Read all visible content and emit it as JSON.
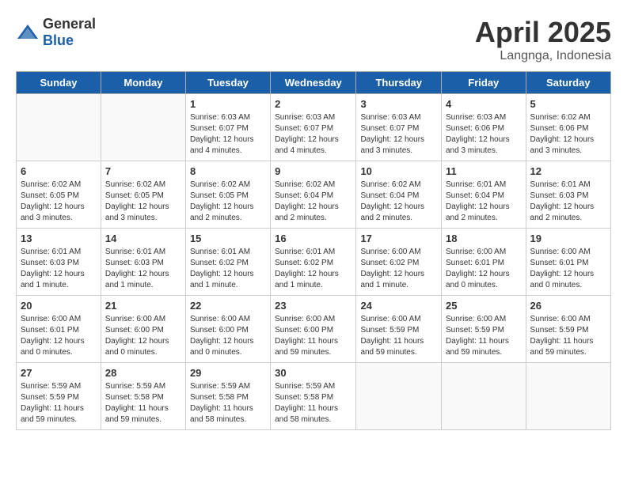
{
  "logo": {
    "text_general": "General",
    "text_blue": "Blue"
  },
  "header": {
    "title": "April 2025",
    "subtitle": "Langnga, Indonesia"
  },
  "calendar": {
    "weekdays": [
      "Sunday",
      "Monday",
      "Tuesday",
      "Wednesday",
      "Thursday",
      "Friday",
      "Saturday"
    ],
    "weeks": [
      [
        {
          "day": "",
          "info": ""
        },
        {
          "day": "",
          "info": ""
        },
        {
          "day": "1",
          "info": "Sunrise: 6:03 AM\nSunset: 6:07 PM\nDaylight: 12 hours\nand 4 minutes."
        },
        {
          "day": "2",
          "info": "Sunrise: 6:03 AM\nSunset: 6:07 PM\nDaylight: 12 hours\nand 4 minutes."
        },
        {
          "day": "3",
          "info": "Sunrise: 6:03 AM\nSunset: 6:07 PM\nDaylight: 12 hours\nand 3 minutes."
        },
        {
          "day": "4",
          "info": "Sunrise: 6:03 AM\nSunset: 6:06 PM\nDaylight: 12 hours\nand 3 minutes."
        },
        {
          "day": "5",
          "info": "Sunrise: 6:02 AM\nSunset: 6:06 PM\nDaylight: 12 hours\nand 3 minutes."
        }
      ],
      [
        {
          "day": "6",
          "info": "Sunrise: 6:02 AM\nSunset: 6:05 PM\nDaylight: 12 hours\nand 3 minutes."
        },
        {
          "day": "7",
          "info": "Sunrise: 6:02 AM\nSunset: 6:05 PM\nDaylight: 12 hours\nand 3 minutes."
        },
        {
          "day": "8",
          "info": "Sunrise: 6:02 AM\nSunset: 6:05 PM\nDaylight: 12 hours\nand 2 minutes."
        },
        {
          "day": "9",
          "info": "Sunrise: 6:02 AM\nSunset: 6:04 PM\nDaylight: 12 hours\nand 2 minutes."
        },
        {
          "day": "10",
          "info": "Sunrise: 6:02 AM\nSunset: 6:04 PM\nDaylight: 12 hours\nand 2 minutes."
        },
        {
          "day": "11",
          "info": "Sunrise: 6:01 AM\nSunset: 6:04 PM\nDaylight: 12 hours\nand 2 minutes."
        },
        {
          "day": "12",
          "info": "Sunrise: 6:01 AM\nSunset: 6:03 PM\nDaylight: 12 hours\nand 2 minutes."
        }
      ],
      [
        {
          "day": "13",
          "info": "Sunrise: 6:01 AM\nSunset: 6:03 PM\nDaylight: 12 hours\nand 1 minute."
        },
        {
          "day": "14",
          "info": "Sunrise: 6:01 AM\nSunset: 6:03 PM\nDaylight: 12 hours\nand 1 minute."
        },
        {
          "day": "15",
          "info": "Sunrise: 6:01 AM\nSunset: 6:02 PM\nDaylight: 12 hours\nand 1 minute."
        },
        {
          "day": "16",
          "info": "Sunrise: 6:01 AM\nSunset: 6:02 PM\nDaylight: 12 hours\nand 1 minute."
        },
        {
          "day": "17",
          "info": "Sunrise: 6:00 AM\nSunset: 6:02 PM\nDaylight: 12 hours\nand 1 minute."
        },
        {
          "day": "18",
          "info": "Sunrise: 6:00 AM\nSunset: 6:01 PM\nDaylight: 12 hours\nand 0 minutes."
        },
        {
          "day": "19",
          "info": "Sunrise: 6:00 AM\nSunset: 6:01 PM\nDaylight: 12 hours\nand 0 minutes."
        }
      ],
      [
        {
          "day": "20",
          "info": "Sunrise: 6:00 AM\nSunset: 6:01 PM\nDaylight: 12 hours\nand 0 minutes."
        },
        {
          "day": "21",
          "info": "Sunrise: 6:00 AM\nSunset: 6:00 PM\nDaylight: 12 hours\nand 0 minutes."
        },
        {
          "day": "22",
          "info": "Sunrise: 6:00 AM\nSunset: 6:00 PM\nDaylight: 12 hours\nand 0 minutes."
        },
        {
          "day": "23",
          "info": "Sunrise: 6:00 AM\nSunset: 6:00 PM\nDaylight: 11 hours\nand 59 minutes."
        },
        {
          "day": "24",
          "info": "Sunrise: 6:00 AM\nSunset: 5:59 PM\nDaylight: 11 hours\nand 59 minutes."
        },
        {
          "day": "25",
          "info": "Sunrise: 6:00 AM\nSunset: 5:59 PM\nDaylight: 11 hours\nand 59 minutes."
        },
        {
          "day": "26",
          "info": "Sunrise: 6:00 AM\nSunset: 5:59 PM\nDaylight: 11 hours\nand 59 minutes."
        }
      ],
      [
        {
          "day": "27",
          "info": "Sunrise: 5:59 AM\nSunset: 5:59 PM\nDaylight: 11 hours\nand 59 minutes."
        },
        {
          "day": "28",
          "info": "Sunrise: 5:59 AM\nSunset: 5:58 PM\nDaylight: 11 hours\nand 59 minutes."
        },
        {
          "day": "29",
          "info": "Sunrise: 5:59 AM\nSunset: 5:58 PM\nDaylight: 11 hours\nand 58 minutes."
        },
        {
          "day": "30",
          "info": "Sunrise: 5:59 AM\nSunset: 5:58 PM\nDaylight: 11 hours\nand 58 minutes."
        },
        {
          "day": "",
          "info": ""
        },
        {
          "day": "",
          "info": ""
        },
        {
          "day": "",
          "info": ""
        }
      ]
    ]
  }
}
